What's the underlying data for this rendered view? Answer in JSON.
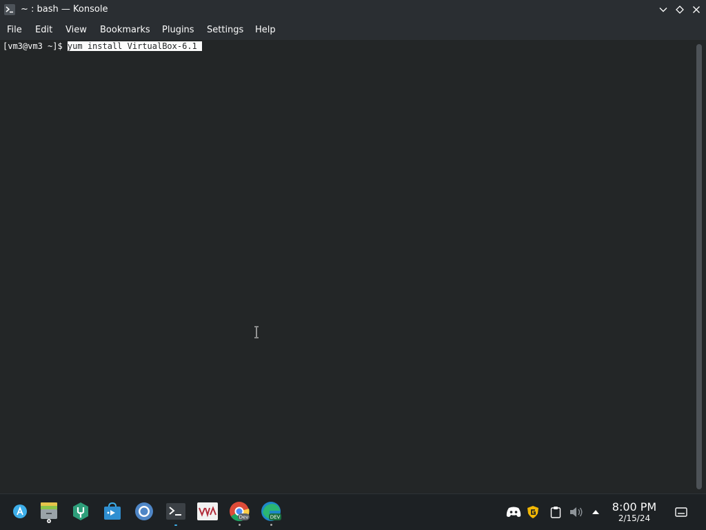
{
  "window": {
    "title": "~ : bash — Konsole"
  },
  "menubar": {
    "items": [
      "File",
      "Edit",
      "View",
      "Bookmarks",
      "Plugins",
      "Settings",
      "Help"
    ]
  },
  "terminal": {
    "prompt": "[vm3@vm3 ~]$ ",
    "command": "yum install VirtualBox-6.1 "
  },
  "taskbar": {
    "apps": [
      {
        "name": "application-launcher-icon"
      },
      {
        "name": "files-icon"
      },
      {
        "name": "system-tool-icon"
      },
      {
        "name": "store-icon"
      },
      {
        "name": "chromium-icon"
      },
      {
        "name": "konsole-icon"
      },
      {
        "name": "vivaldi-like-icon"
      },
      {
        "name": "chrome-dev-icon",
        "badge": "Dev"
      },
      {
        "name": "edge-dev-icon",
        "badge": "DEV"
      }
    ],
    "clock": {
      "time": "8:00 PM",
      "date": "2/15/24"
    }
  },
  "colors": {
    "terminal_bg": "#232627",
    "terminal_fg": "#fcfcfc",
    "titlebar_bg": "#2a2e32",
    "taskbar_bg": "#1d2124",
    "accent": "#3daee9"
  }
}
